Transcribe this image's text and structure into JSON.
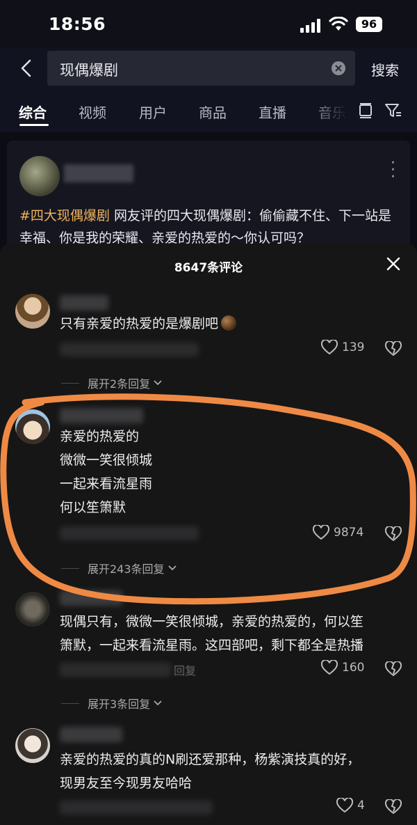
{
  "status_bar": {
    "time": "18:56",
    "battery": "96"
  },
  "search": {
    "query": "现偶爆剧",
    "button_label": "搜索"
  },
  "tabs": [
    {
      "label": "综合"
    },
    {
      "label": "视频"
    },
    {
      "label": "用户"
    },
    {
      "label": "商品"
    },
    {
      "label": "直播"
    },
    {
      "label": "音乐"
    }
  ],
  "post": {
    "hashtag": "#四大现偶爆剧",
    "text": " 网友评的四大现偶爆剧：偷偷藏不住、下一站是幸福、你是我的荣耀、亲爱的热爱的～你认可吗？"
  },
  "comments_sheet": {
    "title": "8647条评论",
    "comments": [
      {
        "text": "只有亲爱的热爱的是爆剧吧",
        "likes": "139",
        "replies_label": "展开2条回复"
      },
      {
        "text": "亲爱的热爱的\n微微一笑很倾城\n一起来看流星雨\n何以笙箫默",
        "likes": "9874",
        "replies_label": "展开243条回复"
      },
      {
        "text": "现偶只有，微微一笑很倾城，亲爱的热爱的，何以笙\n箫默，一起来看流星雨。这四部吧，剩下都全是热播",
        "meta_partial": "回复",
        "likes": "160",
        "replies_label": "展开3条回复"
      },
      {
        "text": "亲爱的热爱的真的N刷还爱那种，杨紫演技真的好，\n现男友至今现男友哈哈",
        "likes": "4"
      }
    ]
  },
  "colors": {
    "hashtag": "#f0b35c",
    "annotation": "#ef8a45",
    "sheet_bg": "#161616"
  }
}
